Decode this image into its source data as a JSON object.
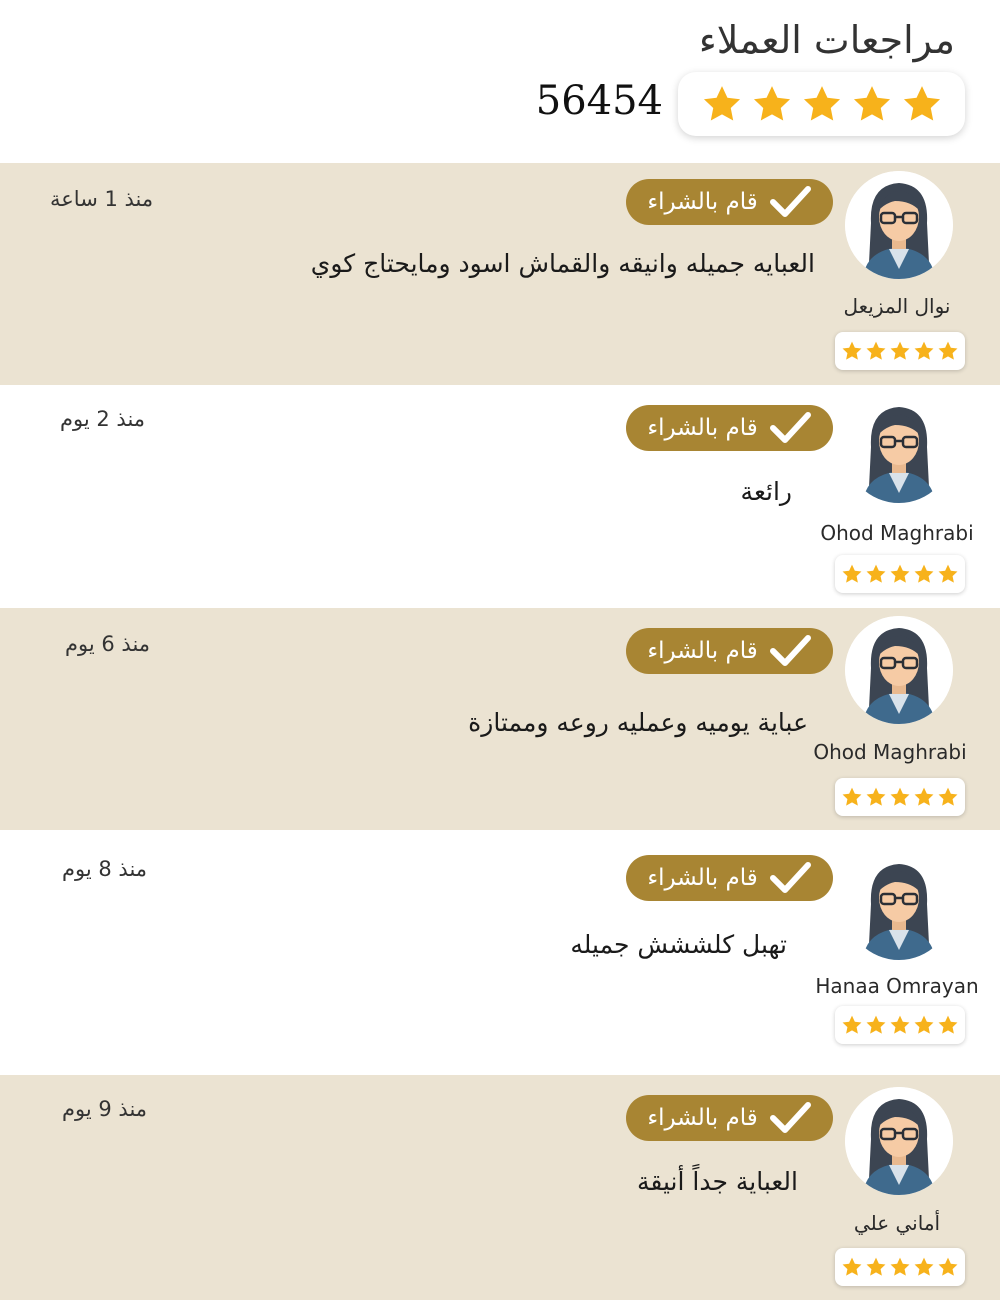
{
  "page": {
    "title": "مراجعات العملاء",
    "total_reviews": "56454",
    "overall_rating": 5
  },
  "colors": {
    "tan_row": "#ebe3d2",
    "badge": "#a88533",
    "star": "#f7b21b"
  },
  "icons": {
    "star": "star-icon",
    "check": "checkmark-icon",
    "avatar": "female-avatar-icon"
  },
  "reviews": [
    {
      "name": "نوال المزيعل",
      "badge": "قام بالشراء",
      "comment": "العبايه جميله وانيقه والقماش اسود ومايحتاج كوي",
      "time": "منذ 1 ساعة",
      "rating": 5
    },
    {
      "name": "Ohod Maghrabi",
      "badge": "قام بالشراء",
      "comment": "رائعة",
      "time": "منذ 2 يوم",
      "rating": 5
    },
    {
      "name": "Ohod Maghrabi",
      "badge": "قام بالشراء",
      "comment": "عباية يوميه وعمليه روعه وممتازة",
      "time": "منذ 6 يوم",
      "rating": 5
    },
    {
      "name": "Hanaa Omrayan",
      "badge": "قام بالشراء",
      "comment": "تهبل كلششش جميله",
      "time": "منذ 8 يوم",
      "rating": 5
    },
    {
      "name": "أماني علي",
      "badge": "قام بالشراء",
      "comment": "العباية جداً أنيقة",
      "time": "منذ 9 يوم",
      "rating": 5
    }
  ]
}
